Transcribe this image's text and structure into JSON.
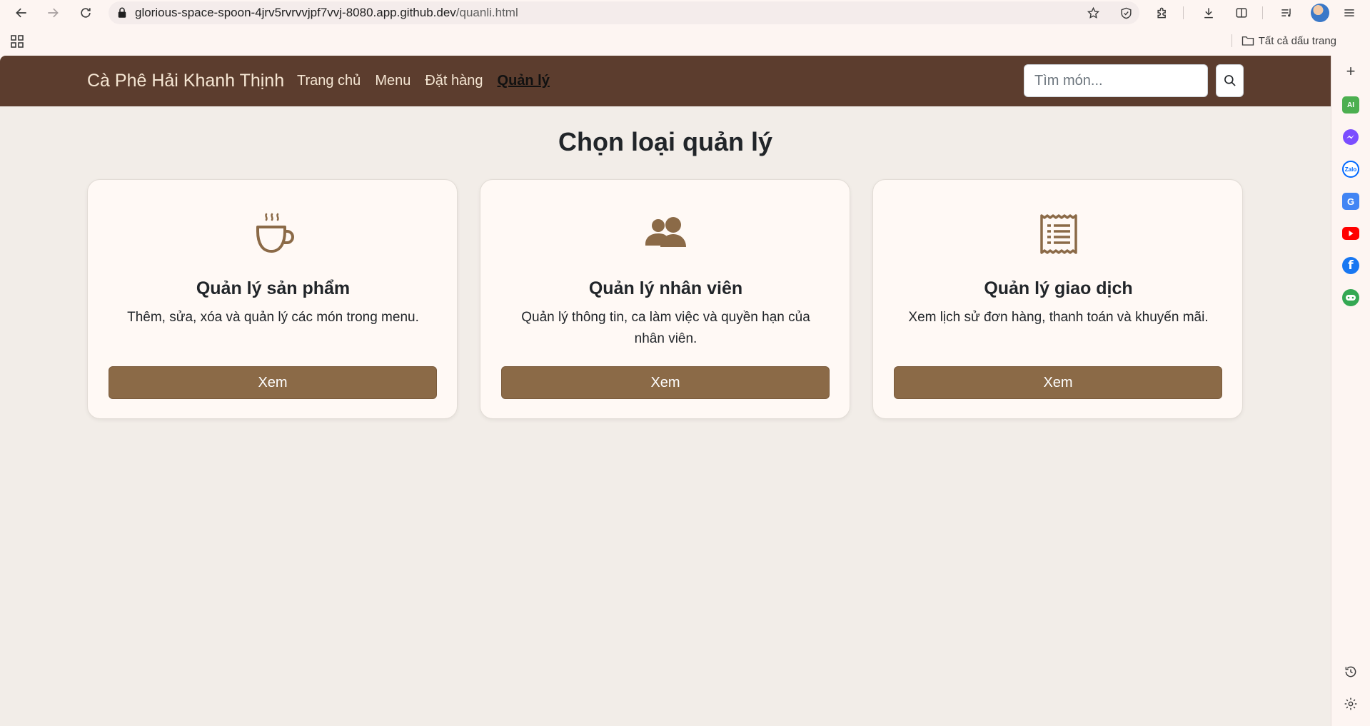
{
  "browser": {
    "url_host": "glorious-space-spoon-4jrv5rvrvvjpf7vvj-8080.app.github.dev",
    "url_path": "/quanli.html",
    "bookmarks_all_label": "Tất cả dấu trang"
  },
  "sidepanel": {
    "ai_label": "AI",
    "zalo_label": "Zalo"
  },
  "navbar": {
    "brand": "Cà Phê Hải Khanh Thịnh",
    "links": [
      "Trang chủ",
      "Menu",
      "Đặt hàng",
      "Quản lý"
    ],
    "active_link": "Quản lý",
    "search_placeholder": "Tìm món..."
  },
  "page": {
    "title": "Chọn loại quản lý"
  },
  "cards": [
    {
      "icon": "coffee-cup-icon",
      "title": "Quản lý sản phẩm",
      "description": "Thêm, sửa, xóa và quản lý các món trong menu.",
      "button": "Xem"
    },
    {
      "icon": "people-icon",
      "title": "Quản lý nhân viên",
      "description": "Quản lý thông tin, ca làm việc và quyền hạn của nhân viên.",
      "button": "Xem"
    },
    {
      "icon": "receipt-icon",
      "title": "Quản lý giao dịch",
      "description": "Xem lịch sử đơn hàng, thanh toán và khuyến mãi.",
      "button": "Xem"
    }
  ],
  "colors": {
    "navbar_bg": "#5c3d2e",
    "button_bg": "#8b6a47",
    "icon_color": "#8b6a47",
    "page_bg": "#f2ede8"
  }
}
